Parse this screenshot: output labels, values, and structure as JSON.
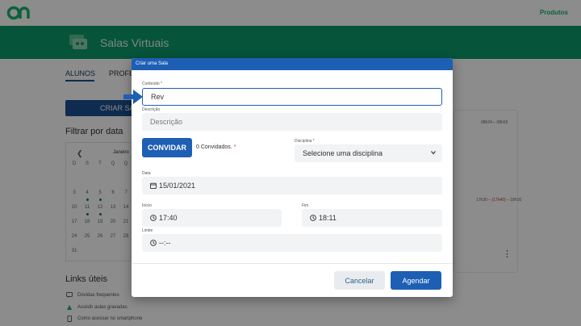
{
  "app": {
    "products_label": "Produtos",
    "page_title": "Salas Virtuais",
    "brand_color": "#0c9a6a",
    "accent_color": "#1d5fb4"
  },
  "tabs": [
    {
      "label": "ALUNOS",
      "active": true
    },
    {
      "label": "PROFE",
      "active": false
    }
  ],
  "create_room_button": "CRIAR SA",
  "filter": {
    "title": "Filtrar por data",
    "month": "Janeiro",
    "weekdays": [
      "D",
      "S",
      "T",
      "Q",
      "Q"
    ],
    "days": [
      "3",
      "4",
      "5",
      "6",
      "7",
      "10",
      "11",
      "12",
      "13",
      "14",
      "17",
      "18",
      "19",
      "20",
      "21",
      "24",
      "25",
      "26",
      "27",
      "28",
      "31"
    ]
  },
  "schedule_card": {
    "time1": "08h24 – 08h55",
    "time2_start": "17h30 – ",
    "time2_late": "(17h40)",
    "time2_end": " – 18h10",
    "menu_icon": "more-vertical-icon"
  },
  "links": {
    "title": "Links úteis",
    "items": [
      "Dúvidas frequentes",
      "Assistir aulas gravadas",
      "Como acessar no smartphone"
    ]
  },
  "modal": {
    "title": "Criar uma Sala",
    "content_label": "Conteúdo *",
    "content_value": "Rev",
    "description_label": "Descrição",
    "description_placeholder": "Descrição",
    "invite_button": "CONVIDAR",
    "invited_count": "0 Convidados.",
    "invited_required": "*",
    "subject_label": "Disciplina *",
    "subject_value": "Selecione uma disciplina",
    "date_label": "Data",
    "date_value": "15/01/2021",
    "start_label": "Início",
    "start_value": "17:40",
    "end_label": "Fim",
    "end_value": "18:11",
    "limit_label": "Limite",
    "limit_value": "--:--",
    "cancel_button": "Cancelar",
    "schedule_button": "Agendar"
  }
}
